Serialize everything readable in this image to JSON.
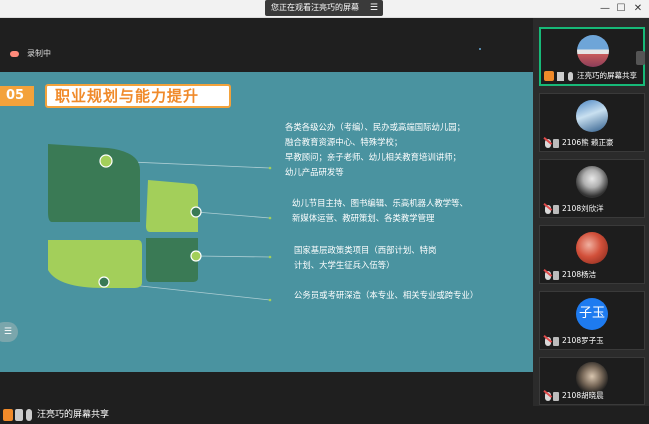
{
  "window": {
    "banner_text": "您正在观看汪亮巧的屏幕",
    "menu_icon": "menu-icon",
    "buttons": [
      "minimize-icon",
      "maximize-icon",
      "close-icon"
    ]
  },
  "recording": {
    "label": "录制中"
  },
  "slide": {
    "number": "05",
    "title": "职业规划与能力提升",
    "items": [
      {
        "lines": [
          "各类各级公办（考编）、民办或高端国际幼儿园；",
          "融合教育资源中心、特殊学校；",
          "早教顾问；亲子老师、幼儿相关教育培训讲师；",
          "幼儿产品研发等"
        ]
      },
      {
        "lines": [
          "幼儿节目主持、图书编辑、乐高机器人教学等、",
          "新媒体运营、教研策划、各类教学管理"
        ]
      },
      {
        "lines": [
          "国家基层政策类项目（西部计划、特岗",
          "计划、大学生征兵入伍等）"
        ]
      },
      {
        "lines": [
          "公务员或考研深造（本专业、相关专业或跨专业）"
        ]
      }
    ],
    "colors": {
      "bg": "#4a93a0",
      "dark_green": "#3a7a55",
      "light_green": "#a3cf5a",
      "accent": "#f3a23b"
    }
  },
  "participants": [
    {
      "name": "汪亮巧的屏幕共享",
      "active": true
    },
    {
      "name": "2106熊 赖正豪",
      "active": false
    },
    {
      "name": "2108刘欣洋",
      "active": false
    },
    {
      "name": "2108杨洁",
      "active": false
    },
    {
      "name": "2108罗子玉",
      "active": false,
      "avatar_text": "子玉",
      "avatar_color": "#1e7bf0"
    },
    {
      "name": "2108胡晓晨",
      "active": false
    }
  ],
  "bottom": {
    "label": "汪亮巧的屏幕共享"
  }
}
